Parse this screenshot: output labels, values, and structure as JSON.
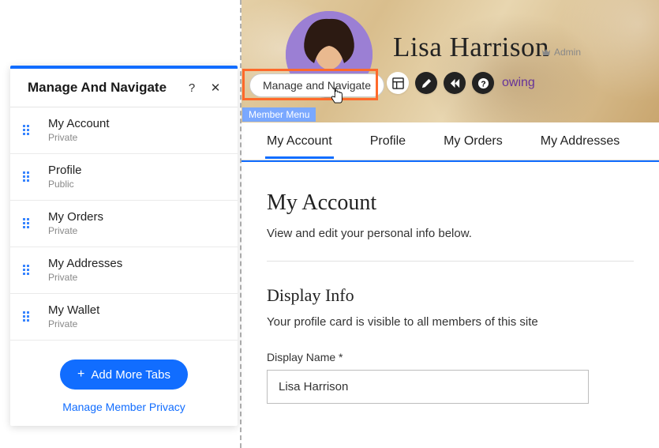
{
  "panel": {
    "title": "Manage And Navigate",
    "help_icon": "?",
    "close_icon": "✕",
    "tabs": [
      {
        "label": "My Account",
        "visibility": "Private"
      },
      {
        "label": "Profile",
        "visibility": "Public"
      },
      {
        "label": "My Orders",
        "visibility": "Private"
      },
      {
        "label": "My Addresses",
        "visibility": "Private"
      },
      {
        "label": "My Wallet",
        "visibility": "Private"
      }
    ],
    "add_button": "Add More Tabs",
    "privacy_link": "Manage Member Privacy"
  },
  "pill_button": "Manage and Navigate",
  "member_menu_tag": "Member Menu",
  "hero": {
    "user_name": "Lisa Harrison",
    "role": "Admin",
    "trailing_text": "owing"
  },
  "topnav": {
    "tabs": [
      {
        "label": "My Account",
        "active": true
      },
      {
        "label": "Profile",
        "active": false
      },
      {
        "label": "My Orders",
        "active": false
      },
      {
        "label": "My Addresses",
        "active": false
      }
    ]
  },
  "content": {
    "heading": "My Account",
    "sub": "View and edit your personal info below.",
    "section_heading": "Display Info",
    "section_desc": "Your profile card is visible to all members of this site",
    "field_label": "Display Name *",
    "display_name_value": "Lisa Harrison"
  }
}
